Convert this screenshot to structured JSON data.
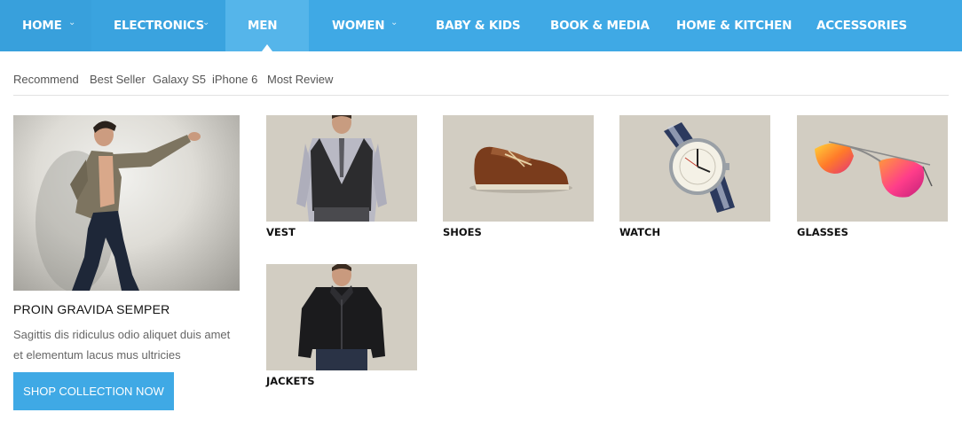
{
  "nav": {
    "items": [
      {
        "label": "HOME"
      },
      {
        "label": "ELECTRONICS"
      },
      {
        "label": "MEN"
      },
      {
        "label": "WOMEN"
      },
      {
        "label": "BABY & KIDS"
      },
      {
        "label": "BOOK & MEDIA"
      },
      {
        "label": "HOME & KITCHEN"
      },
      {
        "label": "ACCESSORIES"
      }
    ],
    "chevron": "⌄",
    "accent": "#3fa9e5"
  },
  "subtabs": [
    "Recommend",
    "Best Seller",
    "Galaxy S5",
    "iPhone 6",
    "Most Review"
  ],
  "feature": {
    "title": "PROIN GRAVIDA SEMPER",
    "description": "Sagittis dis ridiculus odio aliquet duis amet et elementum lacus mus ultricies",
    "button": "SHOP COLLECTION NOW"
  },
  "products": [
    {
      "label": "VEST"
    },
    {
      "label": "SHOES"
    },
    {
      "label": "WATCH"
    },
    {
      "label": "GLASSES"
    },
    {
      "label": "JACKETS"
    }
  ]
}
